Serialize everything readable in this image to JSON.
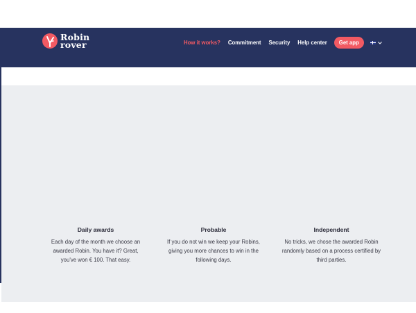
{
  "brand": {
    "line1": "Robin",
    "line2": "rover"
  },
  "nav": {
    "items": [
      {
        "label": "How it works?"
      },
      {
        "label": "Commitment"
      },
      {
        "label": "Security"
      },
      {
        "label": "Help center"
      }
    ],
    "cta_label": "Get app",
    "language_icon": "flag-uk-icon"
  },
  "colors": {
    "navy": "#27335f",
    "accent": "#f25a63",
    "hero_bg": "#eceef1"
  },
  "features": [
    {
      "title": "Daily awards",
      "lines": [
        "Each day of the month we choose an",
        "awarded Robin. You have it? Great,",
        "you've won € 100. That easy."
      ]
    },
    {
      "title": "Probable",
      "lines": [
        "If you do not win we keep your Robins,",
        "giving you more chances to win in the",
        "following days."
      ]
    },
    {
      "title": "Independent",
      "lines": [
        "No tricks, we chose the awarded Robin",
        "randomly based on a process certified by",
        "third parties."
      ]
    }
  ]
}
